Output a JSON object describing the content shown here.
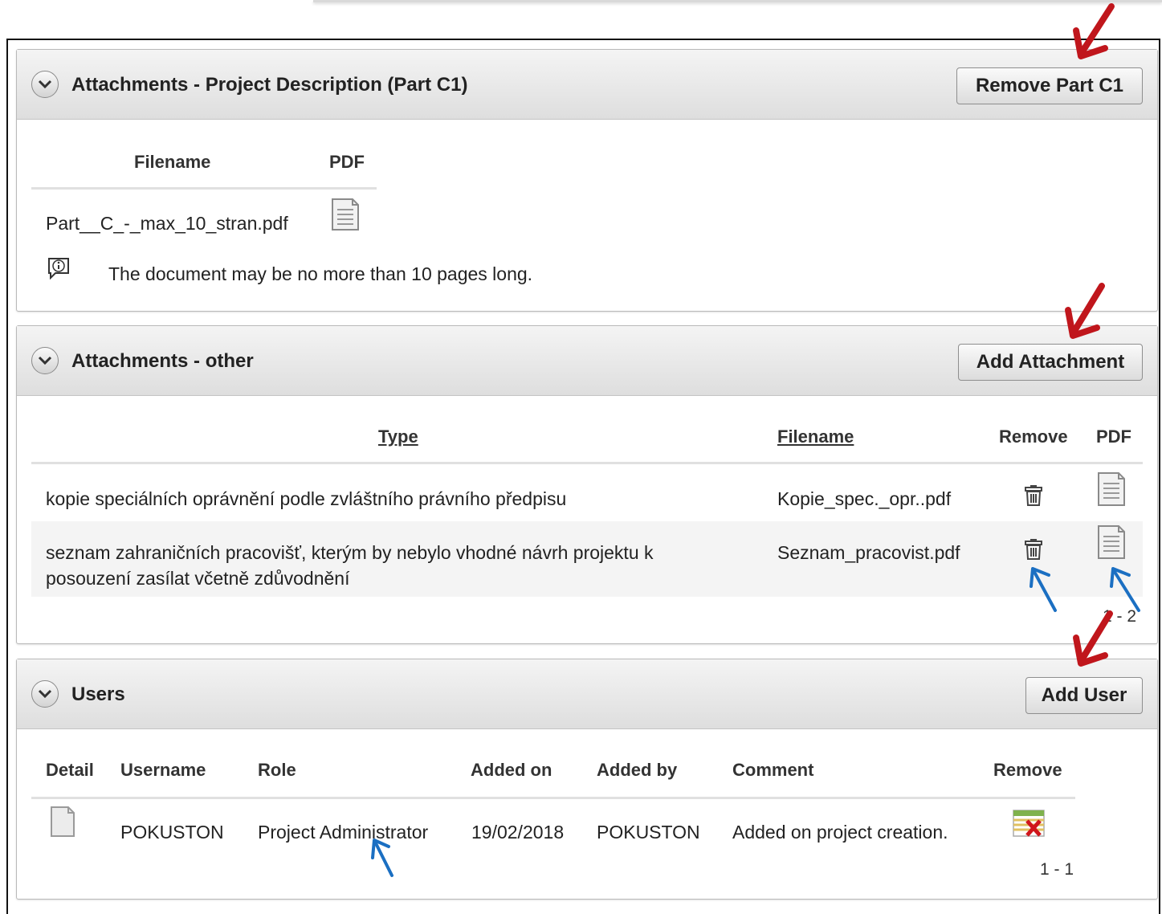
{
  "part_c1": {
    "title": "Attachments - Project Description (Part C1)",
    "button": "Remove Part C1",
    "col_filename": "Filename",
    "col_pdf": "PDF",
    "file": "Part__C_-_max_10_stran.pdf",
    "info": "The document may be no more than 10 pages long."
  },
  "other": {
    "title": "Attachments - other",
    "button": "Add Attachment",
    "col_type": "Type",
    "col_filename": "Filename",
    "col_remove": "Remove",
    "col_pdf": "PDF",
    "rows": [
      {
        "type": "kopie speciálních oprávnění podle zvláštního právního předpisu",
        "filename": "Kopie_spec._opr..pdf"
      },
      {
        "type_line1": "seznam zahraničních pracovišť, kterým by nebylo vhodné návrh projektu k",
        "type_line2": "posouzení zasílat včetně zdůvodnění",
        "filename": "Seznam_pracovist.pdf"
      }
    ],
    "pager": "1 - 2"
  },
  "users": {
    "title": "Users",
    "button": "Add User",
    "columns": {
      "detail": "Detail",
      "username": "Username",
      "role": "Role",
      "added_on": "Added on",
      "added_by": "Added by",
      "comment": "Comment",
      "remove": "Remove"
    },
    "rows": [
      {
        "username": "POKUSTON",
        "role": "Project Administrator",
        "added_on": "19/02/2018",
        "added_by": "POKUSTON",
        "comment": "Added on project creation."
      }
    ],
    "pager": "1 - 1"
  },
  "colors": {
    "annotation_red": "#c0161c",
    "annotation_blue": "#1b6fc2"
  }
}
